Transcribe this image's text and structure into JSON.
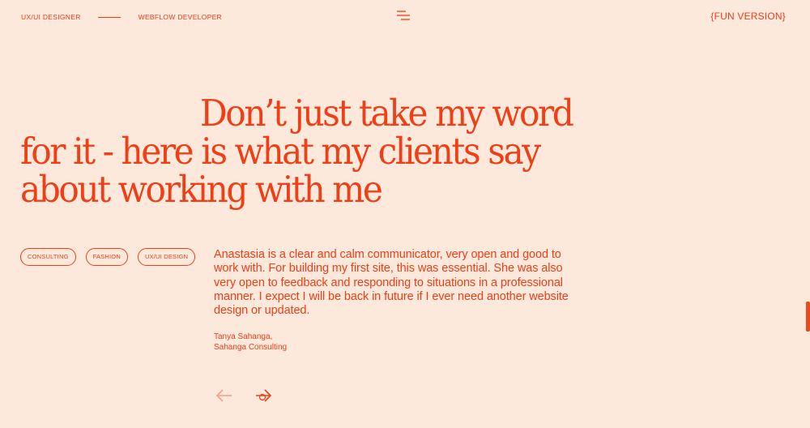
{
  "header": {
    "role_left": "UX/UI DESIGNER",
    "role_right": "WEBFLOW DEVELOPER",
    "menu_icon": "menu-icon",
    "fun_version": "{FUN VERSION}"
  },
  "headline": {
    "line1": "Don’t just take my word",
    "line2": "for it - here is what my clients say",
    "line3": "about working with me"
  },
  "tags": [
    "CONSULTING",
    "FASHION",
    "UX/UI DESIGN"
  ],
  "testimonial": {
    "quote": "Anastasia is a clear and calm communicator, very open and good to work with. For building my first site, this was essential. She was also very open to feedback and responding to situations in a professional manner. I expect I will be back in future if I ever need another website design or updated.",
    "author_name": "Tanya Sahanga,",
    "author_company": "Sahanga Consulting"
  },
  "navigation": {
    "prev_icon": "arrow-left-icon",
    "next_icon": "arrow-right-icon"
  },
  "colors": {
    "background": "#fde8dc",
    "accent": "#ee3f16",
    "muted_accent": "#f5a088"
  }
}
